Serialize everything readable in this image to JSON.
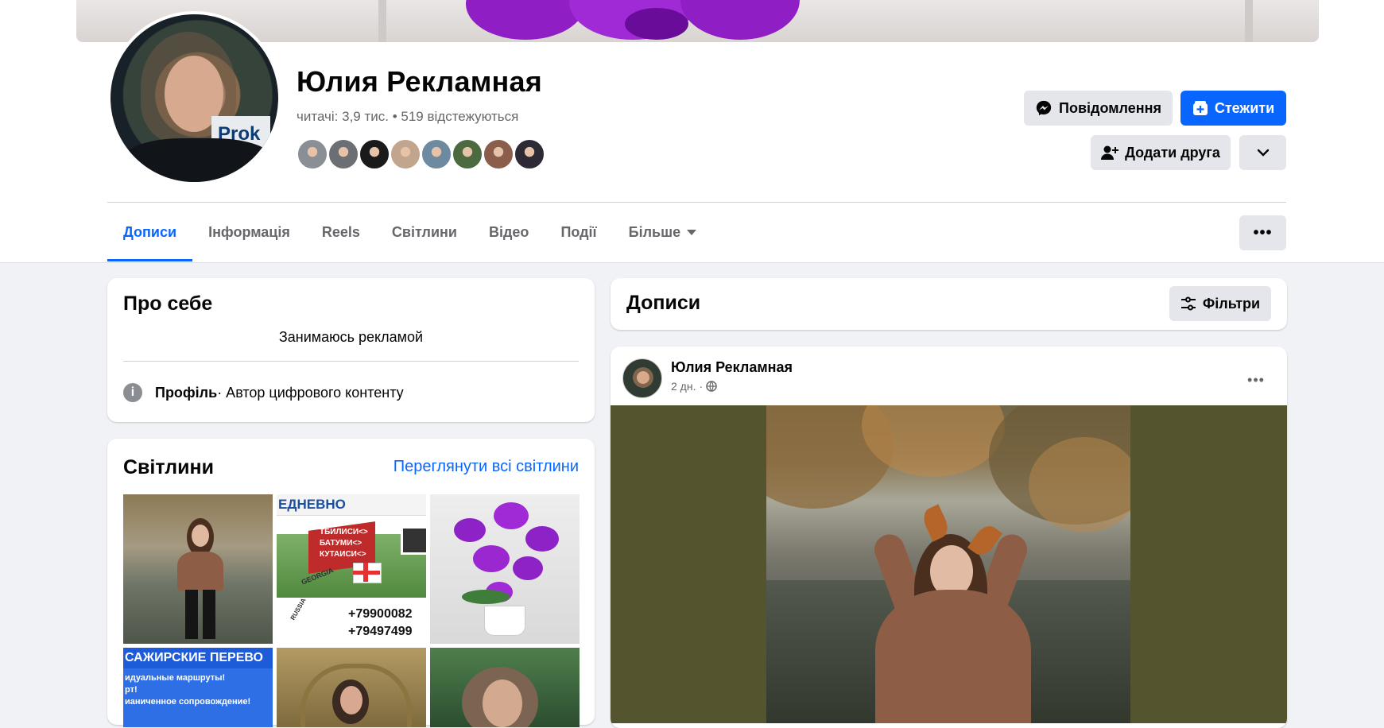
{
  "profile": {
    "name": "Юлия Рекламная",
    "stats_prefix": "читачі: ",
    "followers_count": "3,9 тис.",
    "separator": " • ",
    "following": "519 відстежуються",
    "follower_avatar_colors": [
      "#8a8f95",
      "#6b6f73",
      "#1a1a1a",
      "#c2a58d",
      "#6d8aa0",
      "#4c6a3f",
      "#8b5e4b",
      "#2d2a35"
    ]
  },
  "actions": {
    "message_label": "Повідомлення",
    "follow_label": "Стежити",
    "add_friend_label": "Додати друга",
    "more_icon": "chevron-down-icon",
    "tabs_more_icon": "ellipsis-icon"
  },
  "tabs": [
    {
      "label": "Дописи",
      "active": true
    },
    {
      "label": "Інформація",
      "active": false
    },
    {
      "label": "Reels",
      "active": false
    },
    {
      "label": "Світлини",
      "active": false
    },
    {
      "label": "Відео",
      "active": false
    },
    {
      "label": "Події",
      "active": false
    },
    {
      "label": "Більше",
      "active": false
    }
  ],
  "about": {
    "title": "Про себе",
    "bio": "Занимаюсь рекламой",
    "profile_label": "Профіль",
    "profile_value": " · Автор цифрового контенту"
  },
  "photos": {
    "title": "Світлини",
    "see_all": "Переглянути всі світлини",
    "photo2_text": {
      "line1": "ЕДНЕВНО",
      "line2": "ТБИЛИСИ<>",
      "line3": "БАТУМИ<>",
      "line4": "КУТАИСИ<>",
      "phone1": "+79900082",
      "phone2": "+79497499",
      "georgia": "GEORGIA",
      "russia": "RUSSIA"
    },
    "photo4_text": {
      "line1": "САЖИРСКИЕ ПЕРЕВО",
      "line2": "идуальные маршруты!",
      "line3": "рт!",
      "line4": "ианиченное сопровождение!"
    }
  },
  "posts_section": {
    "title": "Дописи",
    "filters_label": "Фільтри"
  },
  "post": {
    "author": "Юлия Рекламная",
    "time": "2 дн.",
    "dot": " · ",
    "privacy_icon": "globe-icon"
  },
  "colors": {
    "accent": "#0866ff",
    "secondary_text": "#65676b",
    "page_bg": "#f0f2f5",
    "post_image_bg": "#54552f"
  }
}
